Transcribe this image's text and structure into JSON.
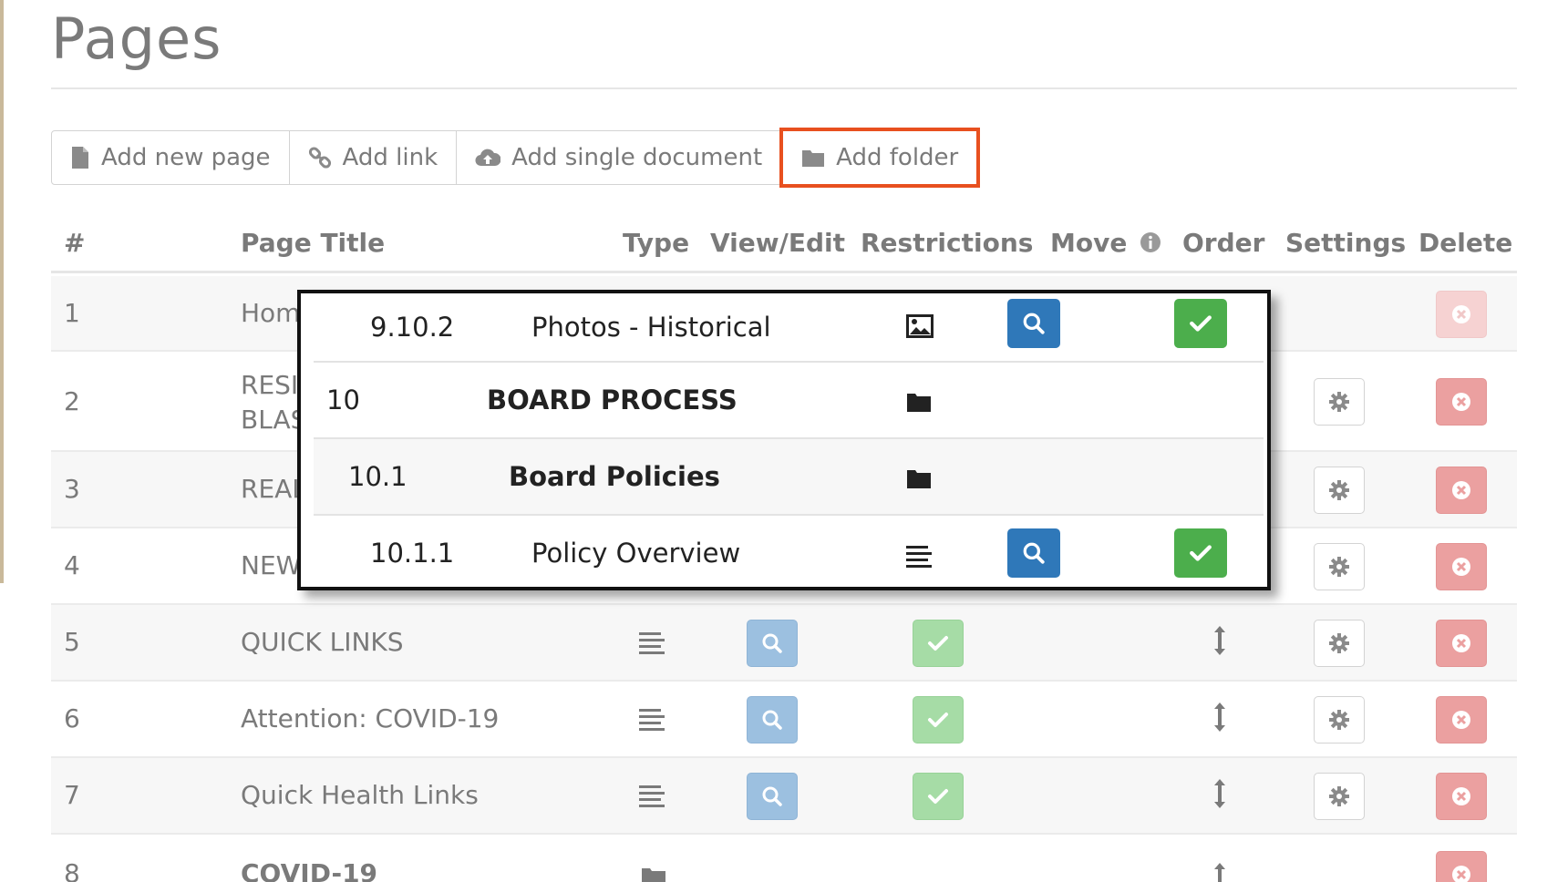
{
  "page": {
    "title": "Pages"
  },
  "toolbar": {
    "add_page": "Add new page",
    "add_link": "Add link",
    "add_document": "Add single document",
    "add_folder": "Add folder"
  },
  "columns": {
    "num": "#",
    "title": "Page Title",
    "type": "Type",
    "view": "View/Edit",
    "restrictions": "Restrictions",
    "move": "Move",
    "order": "Order",
    "settings": "Settings",
    "delete": "Delete"
  },
  "rows": [
    {
      "num": "1",
      "title": "Hom",
      "type": "page"
    },
    {
      "num": "2",
      "title_line1": "RESI",
      "title_line2": "BLAS",
      "type": "page"
    },
    {
      "num": "3",
      "title": "REAL",
      "type": "page"
    },
    {
      "num": "4",
      "title": "NEW",
      "type": "page"
    },
    {
      "num": "5",
      "title": "QUICK LINKS",
      "type": "page"
    },
    {
      "num": "6",
      "title": "Attention: COVID-19",
      "type": "page"
    },
    {
      "num": "7",
      "title": "Quick Health Links",
      "type": "page"
    },
    {
      "num": "8",
      "title": "COVID-19",
      "type": "folder"
    }
  ],
  "overlay_rows": [
    {
      "num": "9.10.2",
      "title": "Photos - Historical",
      "type": "image"
    },
    {
      "num": "10",
      "title": "BOARD PROCESS",
      "type": "folder"
    },
    {
      "num": "10.1",
      "title": "Board Policies",
      "type": "folder"
    },
    {
      "num": "10.1.1",
      "title": "Policy Overview",
      "type": "page"
    }
  ],
  "colors": {
    "highlight": "#e8501f",
    "view": "#2f78b9",
    "restrictions": "#4cae4c",
    "delete": "#eba0a0"
  }
}
